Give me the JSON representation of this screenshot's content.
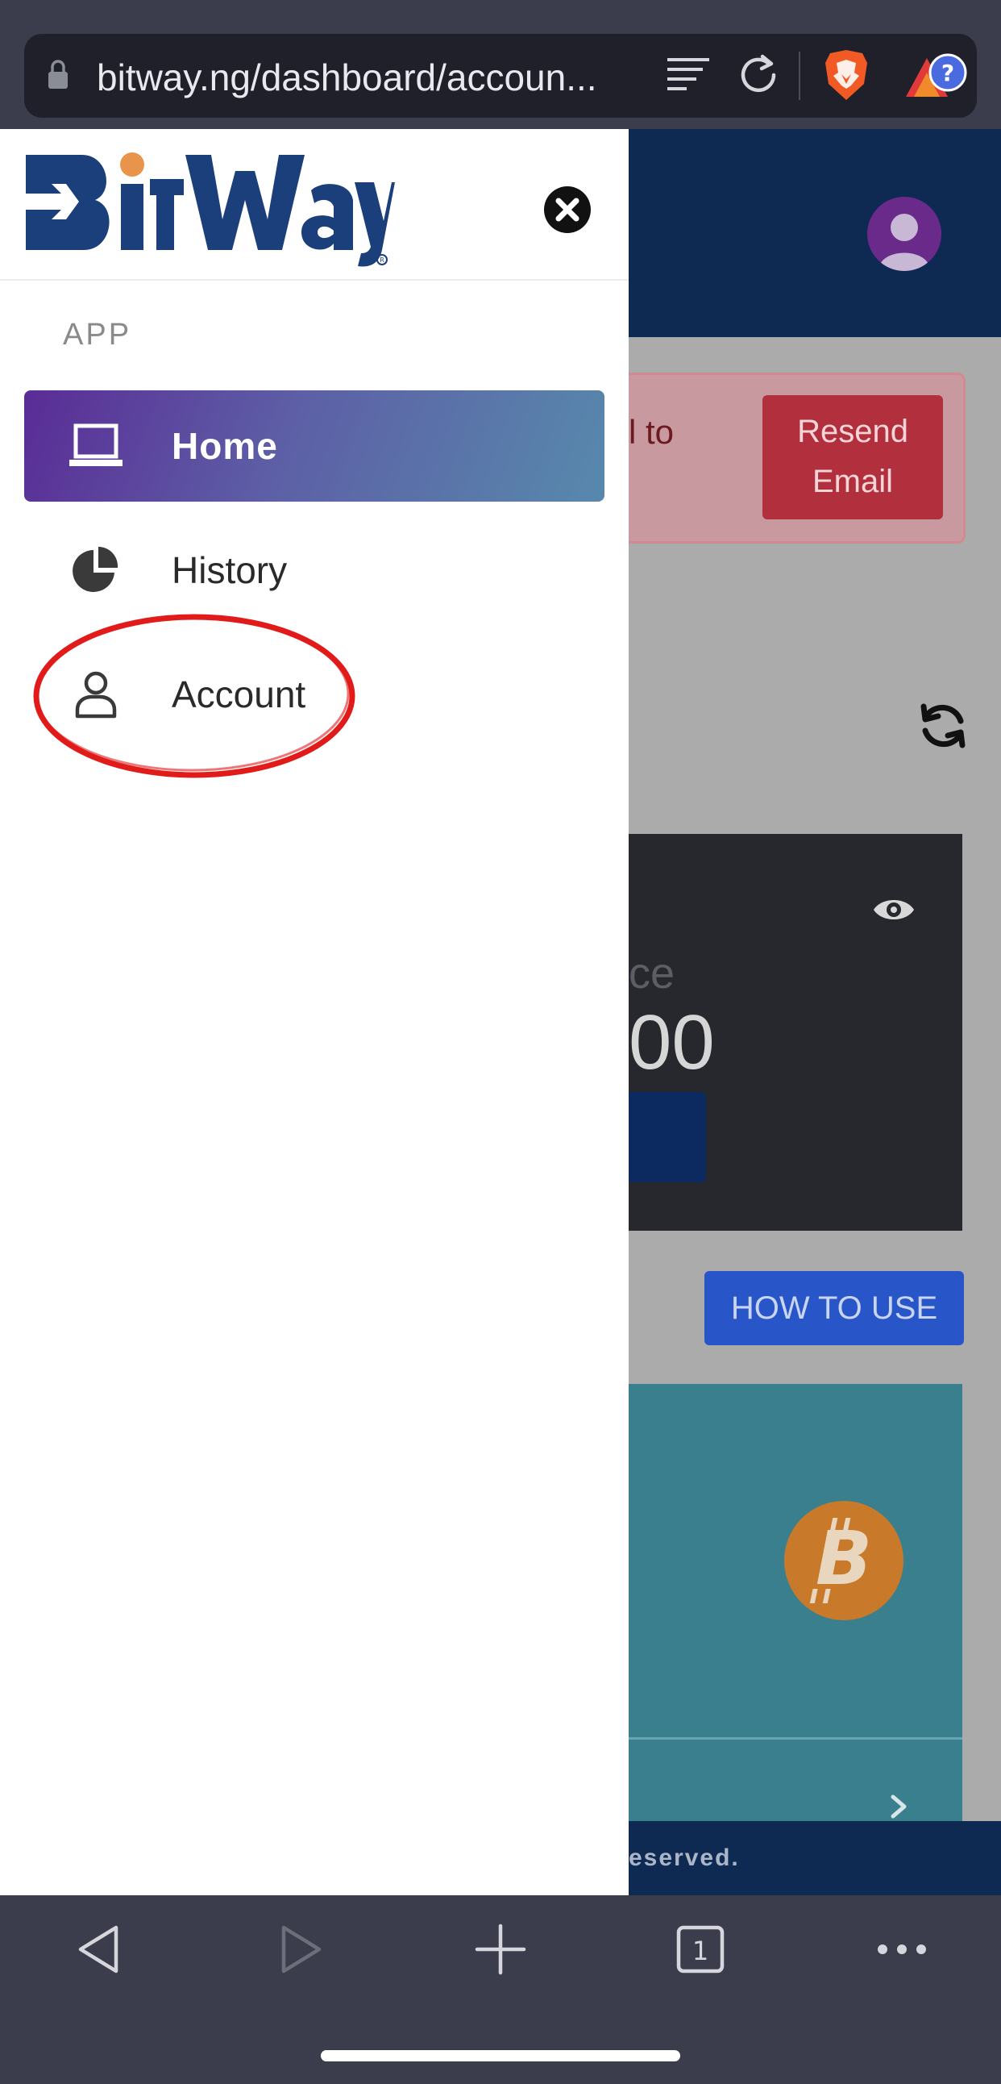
{
  "browser": {
    "url": "bitway.ng/dashboard/accoun..."
  },
  "drawer": {
    "section_label": "APP",
    "items": [
      {
        "label": "Home",
        "icon": "laptop-icon",
        "active": true
      },
      {
        "label": "History",
        "icon": "pie-chart-icon",
        "active": false
      },
      {
        "label": "Account",
        "icon": "user-icon",
        "active": false
      }
    ]
  },
  "background_page": {
    "alert_text": "l to",
    "resend_button": "Resend Email",
    "balance_label_fragment": "ce",
    "balance_amount_fragment": "00",
    "how_to_use_button": "HOW TO USE",
    "footer_fragment": "eserved."
  },
  "colors": {
    "active_item_gradient_start": "#5a2c96",
    "active_item_gradient_end": "#5789ac",
    "brand_blue": "#1b3f7a",
    "brand_orange": "#e8944a",
    "annotation_red": "#e11a1a"
  }
}
